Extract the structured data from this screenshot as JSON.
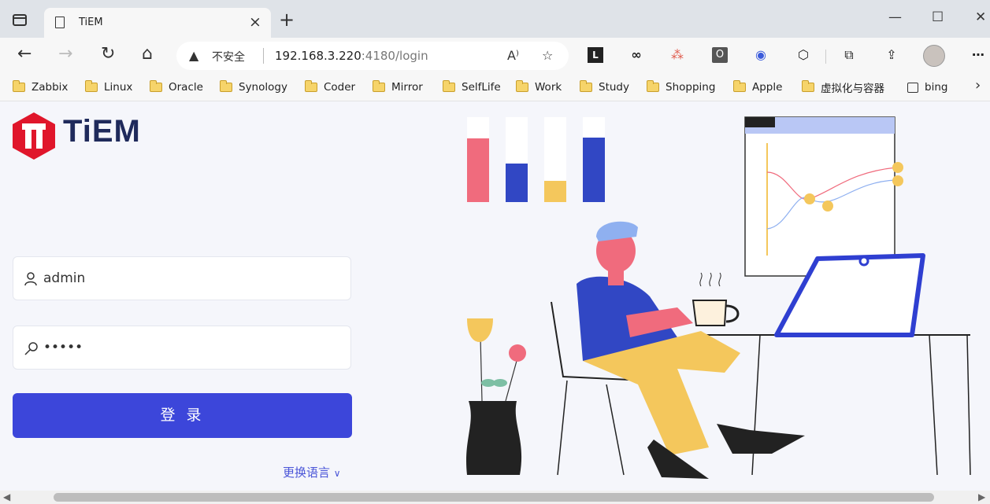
{
  "browser": {
    "tab_title": "TiEM",
    "tab_close": "×",
    "new_tab": "+",
    "window_controls": {
      "minimize": "—",
      "maximize": "☐",
      "close": "✕"
    }
  },
  "toolbar": {
    "back": "←",
    "forward": "→",
    "refresh": "↻",
    "home": "⌂",
    "security_warning_icon": "▲",
    "security_text": "不安全",
    "url_host": "192.168.3.220",
    "url_rest": ":4180/login",
    "read_aloud_icon": "A⁾",
    "favorite_add_icon": "☆",
    "extensions": [
      "L",
      "∞",
      "⁂",
      "O",
      "◉",
      "⬡",
      "⧉",
      "⇪",
      "",
      "⋯"
    ]
  },
  "bookmarks": {
    "items": [
      {
        "label": "Zabbix",
        "icon": "folder-icon"
      },
      {
        "label": "Linux",
        "icon": "folder-icon"
      },
      {
        "label": "Oracle",
        "icon": "folder-icon"
      },
      {
        "label": "Synology",
        "icon": "folder-icon"
      },
      {
        "label": "Coder",
        "icon": "folder-icon"
      },
      {
        "label": "Mirror",
        "icon": "folder-icon"
      },
      {
        "label": "SelfLife",
        "icon": "folder-icon"
      },
      {
        "label": "Work",
        "icon": "folder-icon"
      },
      {
        "label": "Study",
        "icon": "folder-icon"
      },
      {
        "label": "Shopping",
        "icon": "folder-icon"
      },
      {
        "label": "Apple",
        "icon": "folder-icon"
      },
      {
        "label": "虚拟化与容器",
        "icon": "folder-icon"
      },
      {
        "label": "bing",
        "icon": "bing-icon"
      }
    ],
    "more": "›"
  },
  "page": {
    "logo_text": "TiEM",
    "username_value": "admin",
    "password_value": "•••••",
    "login_button": "登 录",
    "language_switch": "更换语言"
  },
  "colors": {
    "brand_red": "#e0162b",
    "brand_navy": "#1f2a5b",
    "primary_button": "#3c46da",
    "link": "#4a55d8"
  }
}
